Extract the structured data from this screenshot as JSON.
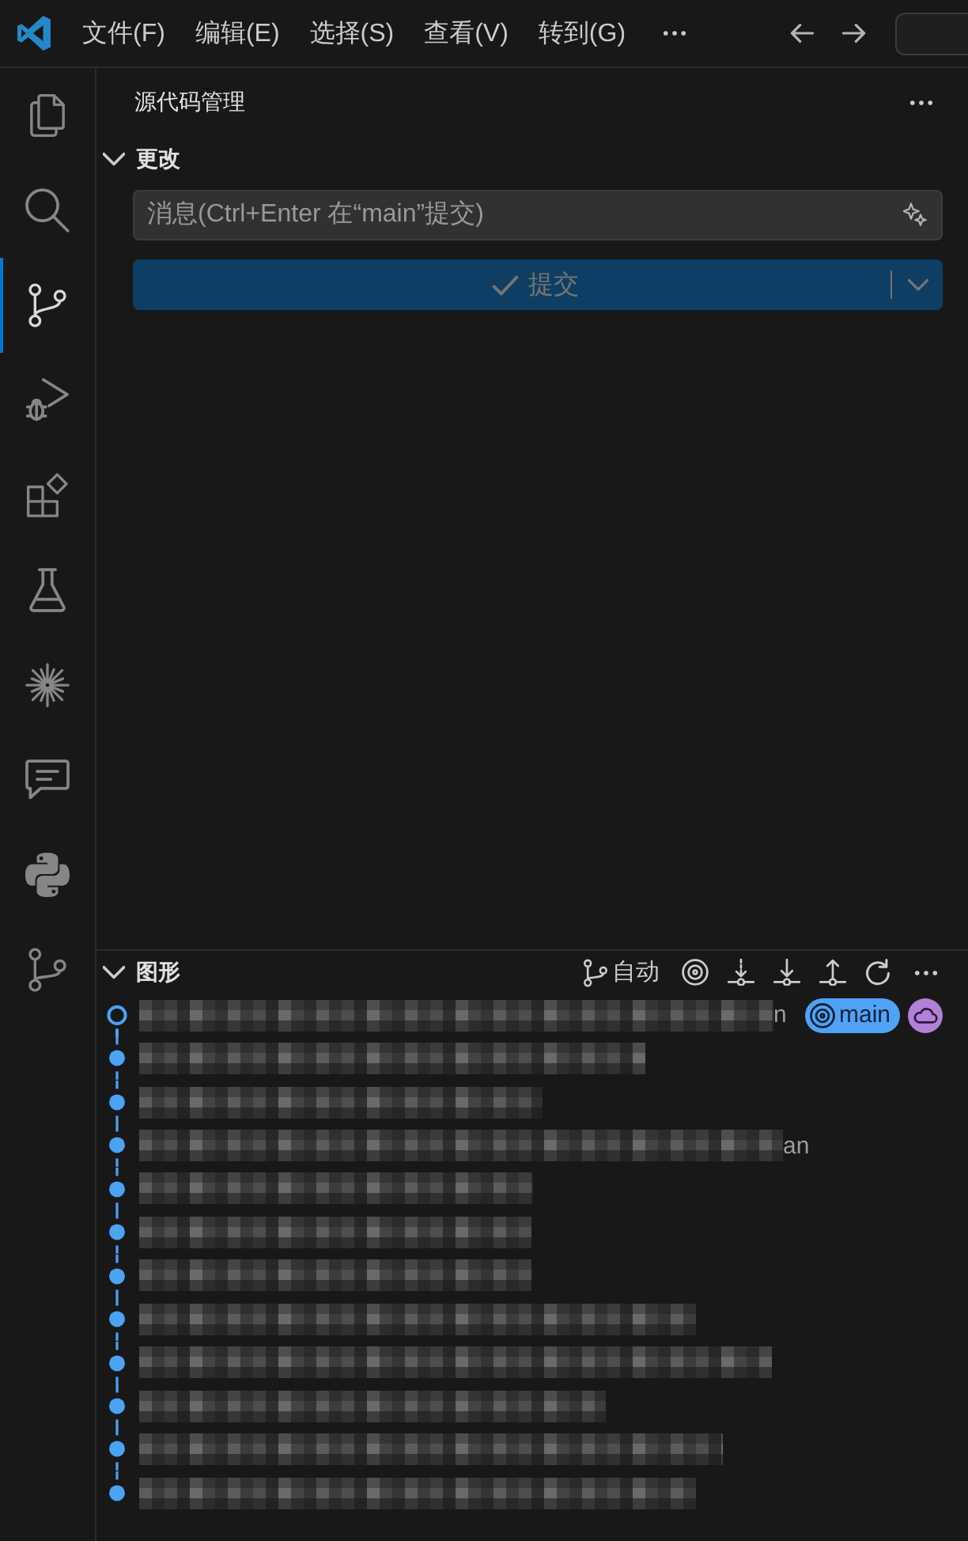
{
  "title_bar": {
    "menus": [
      {
        "label": "文件(F)"
      },
      {
        "label": "编辑(E)"
      },
      {
        "label": "选择(S)"
      },
      {
        "label": "查看(V)"
      },
      {
        "label": "转到(G)"
      }
    ]
  },
  "activity_bar": {
    "items": [
      {
        "kind": "explorer",
        "selected": false
      },
      {
        "kind": "search",
        "selected": false
      },
      {
        "kind": "source_control",
        "selected": true
      },
      {
        "kind": "run_debug",
        "selected": false
      },
      {
        "kind": "extensions",
        "selected": false
      },
      {
        "kind": "testing",
        "selected": false
      },
      {
        "kind": "starburst",
        "selected": false
      },
      {
        "kind": "comments",
        "selected": false
      },
      {
        "kind": "python",
        "selected": false
      },
      {
        "kind": "git_graph",
        "selected": false
      }
    ]
  },
  "sidebar": {
    "title": "源代码管理",
    "changes": {
      "title": "更改",
      "expanded": true,
      "message": {
        "placeholder": "消息(Ctrl+Enter 在“main”提交)"
      },
      "commit_button": {
        "label": "提交",
        "disabled": true
      }
    },
    "graph": {
      "title": "图形",
      "expanded": true,
      "branch_filter": "自动",
      "commits": [
        {
          "current": true,
          "visible_text": "n",
          "refs": [
            {
              "kind": "branch",
              "label": "main",
              "color": "#4fa3f7"
            },
            {
              "kind": "remote",
              "color": "#b180d7"
            }
          ]
        },
        {
          "current": false
        },
        {
          "current": false
        },
        {
          "current": false,
          "visible_text": "an"
        },
        {
          "current": false
        },
        {
          "current": false
        },
        {
          "current": false
        },
        {
          "current": false
        },
        {
          "current": false
        },
        {
          "current": false
        },
        {
          "current": false
        },
        {
          "current": false
        }
      ]
    }
  }
}
